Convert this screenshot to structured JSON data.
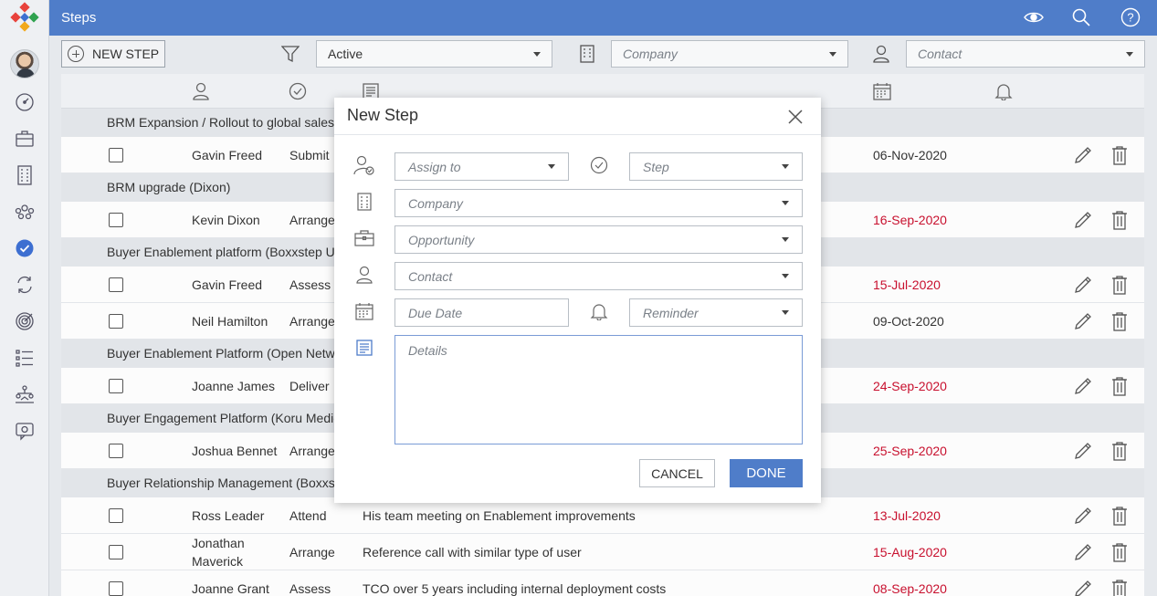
{
  "header": {
    "title": "Steps"
  },
  "toolbar": {
    "new_step_label": "NEW STEP",
    "status_filter": "Active",
    "company_placeholder": "Company",
    "contact_placeholder": "Contact"
  },
  "groups": [
    {
      "title": "BRM Expansion / Rollout to global sales team"
    },
    {
      "title": "BRM upgrade (Dixon)"
    },
    {
      "title": "Buyer Enablement platform (Boxxstep UK)"
    },
    {
      "title": "Buyer Enablement Platform (Open Network)"
    },
    {
      "title": "Buyer Engagement Platform (Koru Medical)"
    },
    {
      "title": "Buyer Relationship Management (Boxxstep)"
    }
  ],
  "rows": [
    {
      "assignee": "Gavin Freed",
      "step": "Submit",
      "details": "",
      "due": "06-Nov-2020",
      "overdue": false
    },
    {
      "assignee": "Kevin Dixon",
      "step": "Arrange",
      "details": "",
      "due": "16-Sep-2020",
      "overdue": true
    },
    {
      "assignee": "Gavin Freed",
      "step": "Assess",
      "details": "",
      "due": "15-Jul-2020",
      "overdue": true
    },
    {
      "assignee": "Neil Hamilton",
      "step": "Arrange",
      "details": "",
      "due": "09-Oct-2020",
      "overdue": false
    },
    {
      "assignee": "Joanne James",
      "step": "Deliver",
      "details": "",
      "due": "24-Sep-2020",
      "overdue": true
    },
    {
      "assignee": "Joshua Bennet",
      "step": "Arrange",
      "details": "",
      "due": "25-Sep-2020",
      "overdue": true
    },
    {
      "assignee": "Ross Leader",
      "step": "Attend",
      "details": "His team meeting on Enablement improvements",
      "due": "13-Jul-2020",
      "overdue": true
    },
    {
      "assignee": "Jonathan Maverick",
      "step": "Arrange",
      "details": "Reference call with similar type of user",
      "due": "15-Aug-2020",
      "overdue": true
    },
    {
      "assignee": "Joanne Grant",
      "step": "Assess",
      "details": "TCO over 5 years including internal deployment costs",
      "due": "08-Sep-2020",
      "overdue": true
    }
  ],
  "modal": {
    "title": "New Step",
    "assign_placeholder": "Assign to",
    "step_placeholder": "Step",
    "company_placeholder": "Company",
    "opportunity_placeholder": "Opportunity",
    "contact_placeholder": "Contact",
    "due_date_placeholder": "Due Date",
    "reminder_placeholder": "Reminder",
    "details_placeholder": "Details",
    "cancel_label": "CANCEL",
    "done_label": "DONE"
  },
  "colors": {
    "accent": "#4f7dc9",
    "overdue": "#c8102e",
    "check": "#3d6fd1"
  }
}
